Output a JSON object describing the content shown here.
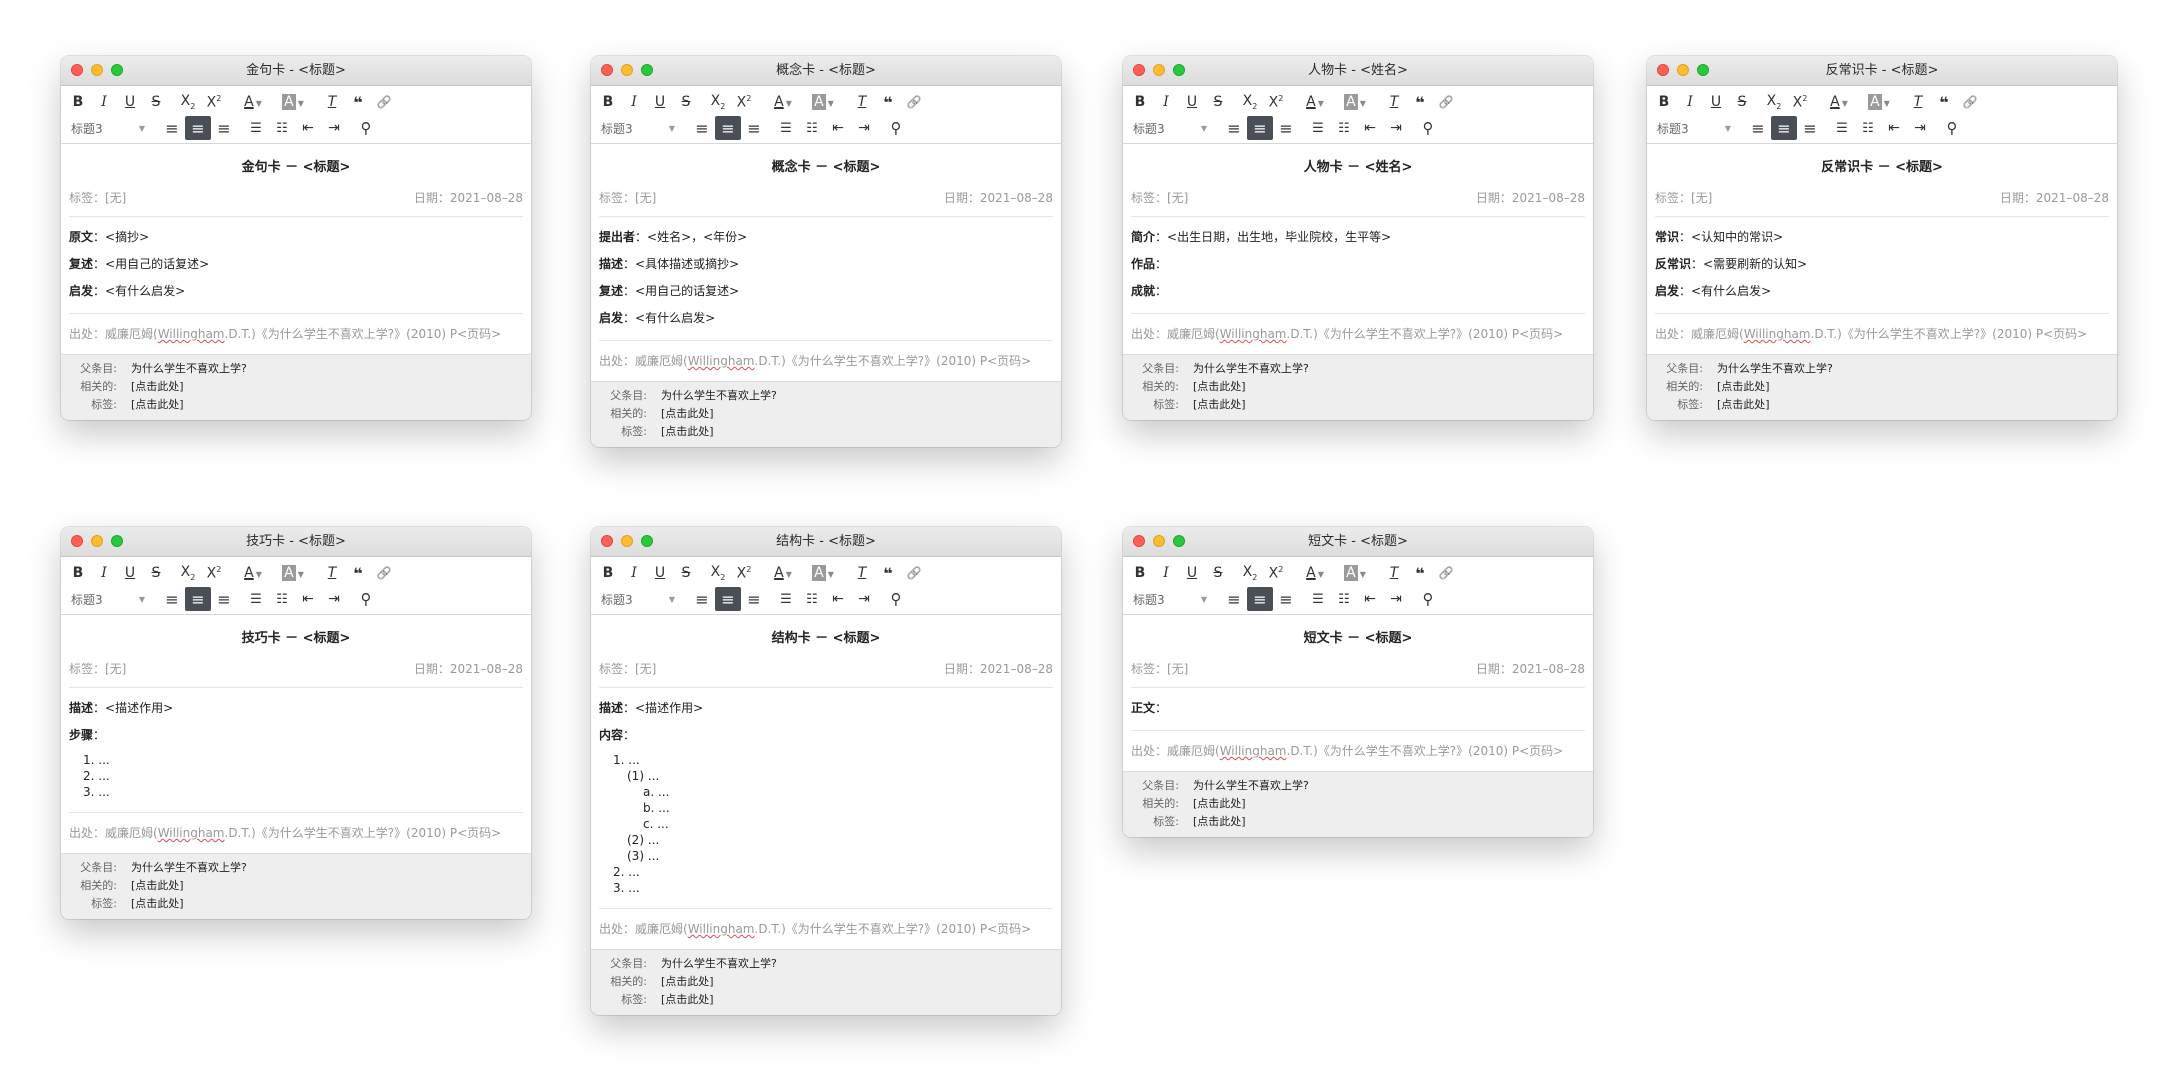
{
  "ui": {
    "style_select": "标题3",
    "meta_tag": "标签：[无]",
    "meta_date": "日期：2021–08–28",
    "footer_parent_label": "父条目:",
    "footer_parent_value": "为什么学生不喜欢上学?",
    "footer_related_label": "相关的:",
    "footer_related_value": "[点击此处]",
    "footer_tags_label": "标签:",
    "footer_tags_value": "[点击此处]",
    "source_prefix": "出处：威廉厄姆(",
    "source_name": "Willingham",
    "source_suffix": ".D.T.)《为什么学生不喜欢上学?》(2010) P<页码>"
  },
  "toolbar_icons": [
    "bold-icon",
    "italic-icon",
    "underline-icon",
    "strikethrough-icon",
    "subscript-icon",
    "superscript-icon",
    "font-color-icon",
    "highlight-color-icon",
    "clear-format-icon",
    "blockquote-icon",
    "link-icon",
    "align-left-icon",
    "align-center-icon",
    "align-right-icon",
    "bulleted-list-icon",
    "numbered-list-icon",
    "outdent-icon",
    "indent-icon",
    "find-icon"
  ],
  "windows": [
    {
      "title": "金句卡 - <标题>",
      "content_title": "金句卡 － <标题>",
      "lines": [
        {
          "label": "原文",
          "text": "：<摘抄>"
        },
        {
          "label": "复述",
          "text": "：<用自己的话复述>"
        },
        {
          "label": "启发",
          "text": "：<有什么启发>"
        }
      ]
    },
    {
      "title": "概念卡 - <标题>",
      "content_title": "概念卡 － <标题>",
      "lines": [
        {
          "label": "提出者",
          "text": "：<姓名>，<年份>"
        },
        {
          "label": "描述",
          "text": "：<具体描述或摘抄>"
        },
        {
          "label": "复述",
          "text": "：<用自己的话复述>"
        },
        {
          "label": "启发",
          "text": "：<有什么启发>"
        }
      ]
    },
    {
      "title": "人物卡 - <姓名>",
      "content_title": "人物卡 － <姓名>",
      "lines": [
        {
          "label": "简介",
          "text": "：<出生日期，出生地，毕业院校，生平等>"
        },
        {
          "label": "作品",
          "text": "："
        },
        {
          "label": "成就",
          "text": "："
        }
      ]
    },
    {
      "title": "反常识卡 - <标题>",
      "content_title": "反常识卡 － <标题>",
      "lines": [
        {
          "label": "常识",
          "text": "：<认知中的常识>"
        },
        {
          "label": "反常识",
          "text": "：<需要刷新的认知>"
        },
        {
          "label": "启发",
          "text": "：<有什么启发>"
        }
      ]
    },
    {
      "title": "技巧卡 - <标题>",
      "content_title": "技巧卡 － <标题>",
      "lines": [
        {
          "label": "描述",
          "text": "：<描述作用>"
        },
        {
          "label": "步骤",
          "text": "："
        }
      ],
      "list": [
        {
          "level": 1,
          "text": "1. ..."
        },
        {
          "level": 1,
          "text": "2. ..."
        },
        {
          "level": 1,
          "text": "3. ..."
        }
      ]
    },
    {
      "title": "结构卡 - <标题>",
      "content_title": "结构卡 － <标题>",
      "lines": [
        {
          "label": "描述",
          "text": "：<描述作用>"
        },
        {
          "label": "内容",
          "text": "："
        }
      ],
      "list": [
        {
          "level": 1,
          "text": "1. ..."
        },
        {
          "level": 2,
          "text": "(1) ..."
        },
        {
          "level": 3,
          "text": "a. ..."
        },
        {
          "level": 3,
          "text": "b. ..."
        },
        {
          "level": 3,
          "text": "c. ..."
        },
        {
          "level": 2,
          "text": "(2) ..."
        },
        {
          "level": 2,
          "text": "(3) ..."
        },
        {
          "level": 1,
          "text": "2. ..."
        },
        {
          "level": 1,
          "text": "3. ..."
        }
      ]
    },
    {
      "title": "短文卡 - <标题>",
      "content_title": "短文卡 － <标题>",
      "lines": [
        {
          "label": "正文",
          "text": "："
        }
      ]
    }
  ]
}
